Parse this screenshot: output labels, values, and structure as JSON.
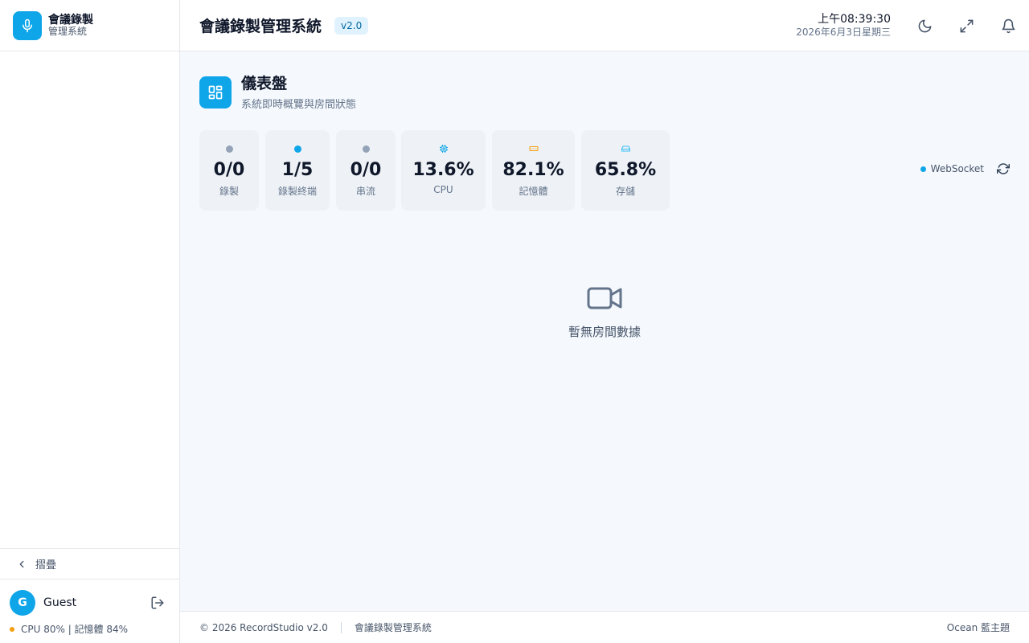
{
  "sidebar": {
    "brand_title": "會議錄製",
    "brand_sub": "管理系統",
    "brand_icon": "microphone-icon",
    "collapse_label": "摺疊",
    "user": {
      "avatar_letter": "G",
      "name": "Guest"
    },
    "system_status": "CPU 80% | 記憶體 84%"
  },
  "header": {
    "title": "會議錄製管理系統",
    "version": "v2.0",
    "time": "上午08:39:30",
    "date": "2026年6月3日星期三",
    "buttons": [
      "moon-icon",
      "expand-icon",
      "bell-icon"
    ]
  },
  "page": {
    "title": "儀表盤",
    "subtitle": "系統即時概覽與房間狀態",
    "icon": "dashboard-icon"
  },
  "stats": [
    {
      "value": "0/0",
      "label": "錄製",
      "icon": "status-dot",
      "color": "#94a3b8"
    },
    {
      "value": "1/5",
      "label": "錄製終端",
      "icon": "status-dot",
      "color": "#0ea5e9"
    },
    {
      "value": "0/0",
      "label": "串流",
      "icon": "status-dot",
      "color": "#94a3b8"
    },
    {
      "value": "13.6%",
      "label": "CPU",
      "icon": "cpu-icon",
      "color": "#0ea5e9"
    },
    {
      "value": "82.1%",
      "label": "記憶體",
      "icon": "memory-icon",
      "color": "#f59e0b"
    },
    {
      "value": "65.8%",
      "label": "存儲",
      "icon": "storage-icon",
      "color": "#38bdf8"
    }
  ],
  "connection": {
    "label": "WebSocket",
    "color": "#0ea5e9"
  },
  "empty_state": {
    "text": "暫無房間數據",
    "icon": "video-camera-icon"
  },
  "footer": {
    "copyright": "© 2026 RecordStudio v2.0",
    "system_name": "會議錄製管理系統",
    "theme": "Ocean 藍主題"
  }
}
